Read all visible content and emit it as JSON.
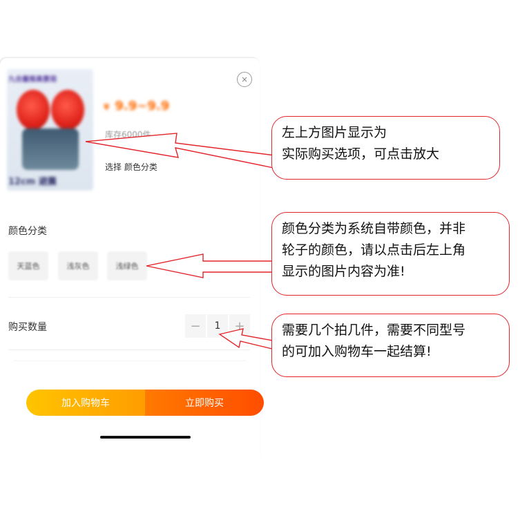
{
  "product": {
    "thumb_title": "九合童推高景观",
    "thumb_caption": "12cm 避震",
    "price_symbol": "¥",
    "price_range": "9.9~9.9",
    "stock": "库存6000件",
    "select_line": "选择 颜色分类",
    "close_symbol": "×"
  },
  "color_section": {
    "label": "颜色分类",
    "options": [
      "天蓝色",
      "浅灰色",
      "浅绿色"
    ]
  },
  "quantity": {
    "label": "购买数量",
    "minus": "−",
    "value": "1",
    "plus": "+"
  },
  "actions": {
    "add_to_cart": "加入购物车",
    "buy_now": "立即购买"
  },
  "callouts": [
    {
      "lines": [
        "左上方图片显示为",
        "实际购买选项，可点击放大"
      ]
    },
    {
      "lines": [
        "颜色分类为系统自带颜色，并非",
        "轮子的颜色，请以点击后左上角",
        "显示的图片内容为准!"
      ]
    },
    {
      "lines": [
        "需要几个拍几件，需要不同型号",
        "的可加入购物车一起结算!"
      ]
    }
  ],
  "colors": {
    "price": "#ff6a00",
    "cart_button": "#ffb300",
    "buy_button": "#ff5a00",
    "callout_border": "#e3242b"
  }
}
